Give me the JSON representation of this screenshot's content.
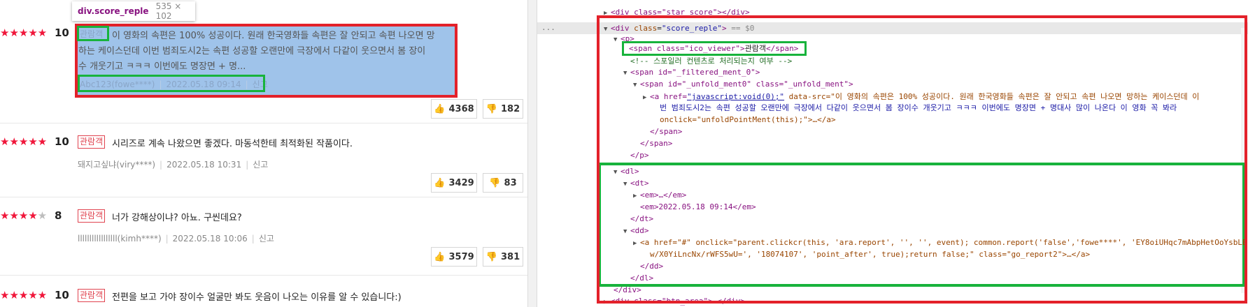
{
  "tooltip": {
    "tag": "div.score_reple",
    "size": "535 × 102"
  },
  "reviews": [
    {
      "stars": "★★★★★",
      "grey_stars": "",
      "score": "10",
      "badge": "관람객",
      "lines": [
        "이 영화의 속편은 100% 성공이다. 원래 한국영화들 속편은 잘 안되고 속편 나오면 망",
        "하는 케이스던데 이번 범죄도시2는 속편 성공할 오랜만에 극장에서 다같이 웃으면서 봄 장이",
        "수 개웃기고 ㅋㅋㅋ 이번에도 명장면 + 명..."
      ],
      "author": "Abc123(fowe****)",
      "date": "2022.05.18 09:14",
      "report": "신고",
      "likes": "4368",
      "dislikes": "182"
    },
    {
      "stars": "★★★★★",
      "grey_stars": "",
      "score": "10",
      "badge": "관람객",
      "text": "시리즈로 계속 나왔으면 좋겠다. 마동석한테 최적화된 작품이다.",
      "author": "돼지고싶냐(viry****)",
      "date": "2022.05.18 10:31",
      "report": "신고",
      "likes": "3429",
      "dislikes": "83"
    },
    {
      "stars": "★★★★",
      "grey_stars": "★",
      "score": "8",
      "badge": "관람객",
      "text": "너가 강해상이냐? 아뇨. 구씬데요?",
      "author": "lllllllllllllllll(kimh****)",
      "date": "2022.05.18 10:06",
      "report": "신고",
      "likes": "3579",
      "dislikes": "381"
    },
    {
      "stars": "★★★★★",
      "grey_stars": "",
      "score": "10",
      "badge": "관람객",
      "text": "전편을 보고 가야 장이수 얼굴만 봐도 웃음이 나오는 이유를 알 수 있습니다:)"
    }
  ],
  "devtools": {
    "selected_suffix": "== $0",
    "gutter": "...",
    "lines": {
      "l0": "<div class=\"star_score\"></div>",
      "score_open_tag": "div",
      "score_attr": "class",
      "score_val": "\"score_reple\"",
      "p_open": "<p>",
      "ico_span": "<span class=\"ico_viewer\">",
      "ico_text": "관람객",
      "ico_close": "</span>",
      "comment": "<!-- 스포일러 컨텐츠로 처리되는지 여부 -->",
      "filtered": "<span id=\"_filtered_ment_0\">",
      "unfold": "<span id=\"_unfold_ment0\" class=\"_unfold_ment\">",
      "a_line1_pre": "<a href=",
      "a_line1_link": "\"javascript:void(0);\"",
      "a_line1_post": " data-src=\"이 영화의 속편은 100% 성공이다. 원래 한국영화들 속편은 잘 안되고 속편 나오면 망하는 케이스던데 이",
      "a_line2": "번 범죄도시2는 속편 성공할 오랜만에 극장에서 다같이 웃으면서 봄 장이수 개웃기고 ㅋㅋㅋ 이번에도 명장면 + 명대사 많이 나온다 이 영화 꼭 봐라",
      "a_line3": "onclick=\"unfoldPointMent(this);\">…</a>",
      "span_close1": "</span>",
      "span_close2": "</span>",
      "p_close": "</p>",
      "dl_open": "<dl>",
      "dt_open": "<dt>",
      "em1": "<em>…</em>",
      "em2": "<em>2022.05.18 09:14</em>",
      "dt_close": "</dt>",
      "dd_open": "<dd>",
      "dd_a1": "<a href=\"#\" onclick=\"parent.clickcr(this, 'ara.report', '', '', event); common.report('false','fowe****', 'EY8oiUHqc7mAbpHetOoYsbLE",
      "dd_a2": "w/X0YiLncNx/rWFS5wU=', '18074107', 'point_after', true);return false;\" class=\"go_report2\">…</a>",
      "dd_close": "</dd>",
      "dl_close": "</dl>",
      "div_close": "</div>",
      "btn_area": "<div class=\"btn_area\">…</div>"
    }
  },
  "colors": {
    "star": "#f0163a",
    "badge": "#e0434f",
    "annot_red": "#e3212a",
    "annot_green": "#18b33c",
    "highlight": "#9fc3ea"
  },
  "icons": {
    "like": "thumbs-up-icon",
    "dislike": "thumbs-down-icon"
  }
}
